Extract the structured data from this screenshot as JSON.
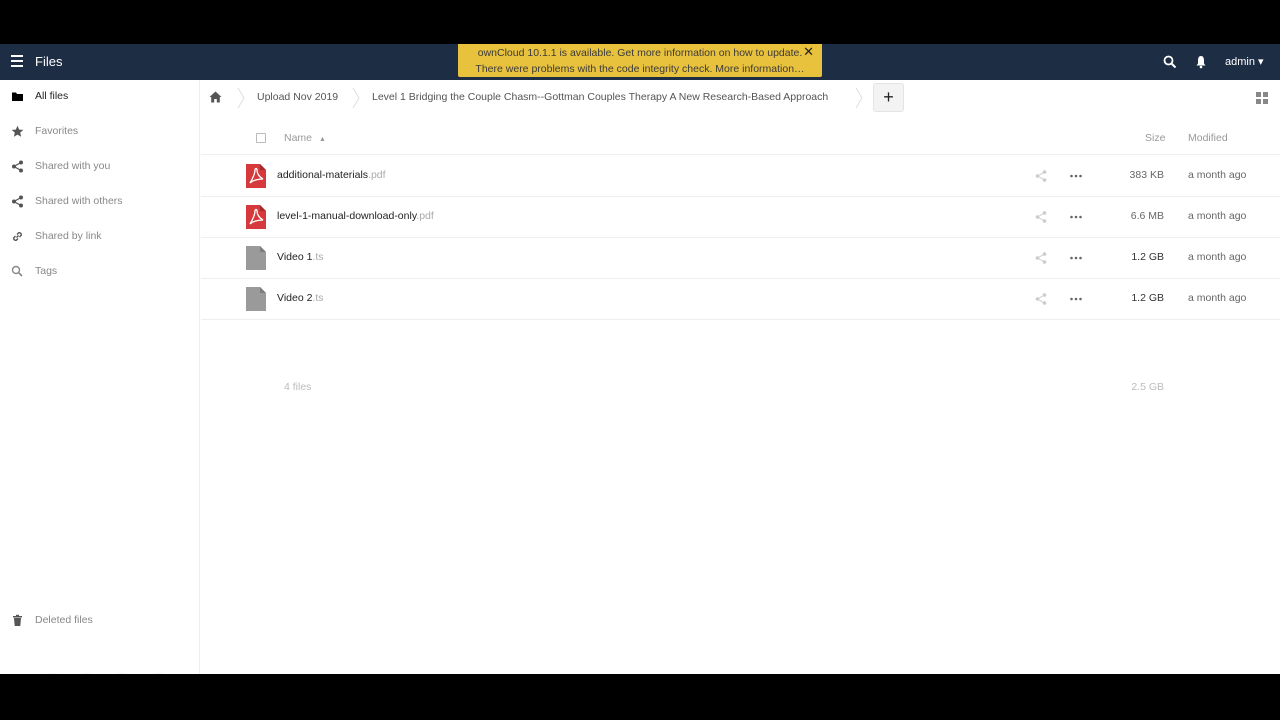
{
  "header": {
    "app_title": "Files",
    "user": "admin ▾"
  },
  "notification": {
    "line1": "ownCloud 10.1.1 is available. Get more information on how to update.",
    "line2": "There were problems with the code integrity check. More information…",
    "close": "✕"
  },
  "sidebar": {
    "items": [
      {
        "label": "All files"
      },
      {
        "label": "Favorites"
      },
      {
        "label": "Shared with you"
      },
      {
        "label": "Shared with others"
      },
      {
        "label": "Shared by link"
      },
      {
        "label": "Tags"
      }
    ],
    "deleted": "Deleted files"
  },
  "breadcrumb": {
    "items": [
      "Upload Nov 2019",
      "Level 1 Bridging the Couple Chasm--Gottman Couples Therapy A New Research-Based Approach"
    ],
    "add": "+"
  },
  "table": {
    "col_name": "Name",
    "sort_arrow": "▲",
    "col_size": "Size",
    "col_modified": "Modified",
    "rows": [
      {
        "name": "additional-materials",
        "ext": ".pdf",
        "size": "383 KB",
        "modified": "a month ago"
      },
      {
        "name": "level-1-manual-download-only",
        "ext": ".pdf",
        "size": "6.6 MB",
        "modified": "a month ago"
      },
      {
        "name": "Video 1",
        "ext": ".ts",
        "size": "1.2 GB",
        "modified": "a month ago"
      },
      {
        "name": "Video 2",
        "ext": ".ts",
        "size": "1.2 GB",
        "modified": "a month ago"
      }
    ],
    "summary_count": "4 files",
    "summary_size": "2.5 GB"
  },
  "controls": {
    "more": "···"
  },
  "colors": {
    "header_bg": "#1d2d44",
    "notification_bg": "#e8c13d",
    "pdf_red": "#d5393b",
    "confirm_green": "#2fd06e"
  }
}
